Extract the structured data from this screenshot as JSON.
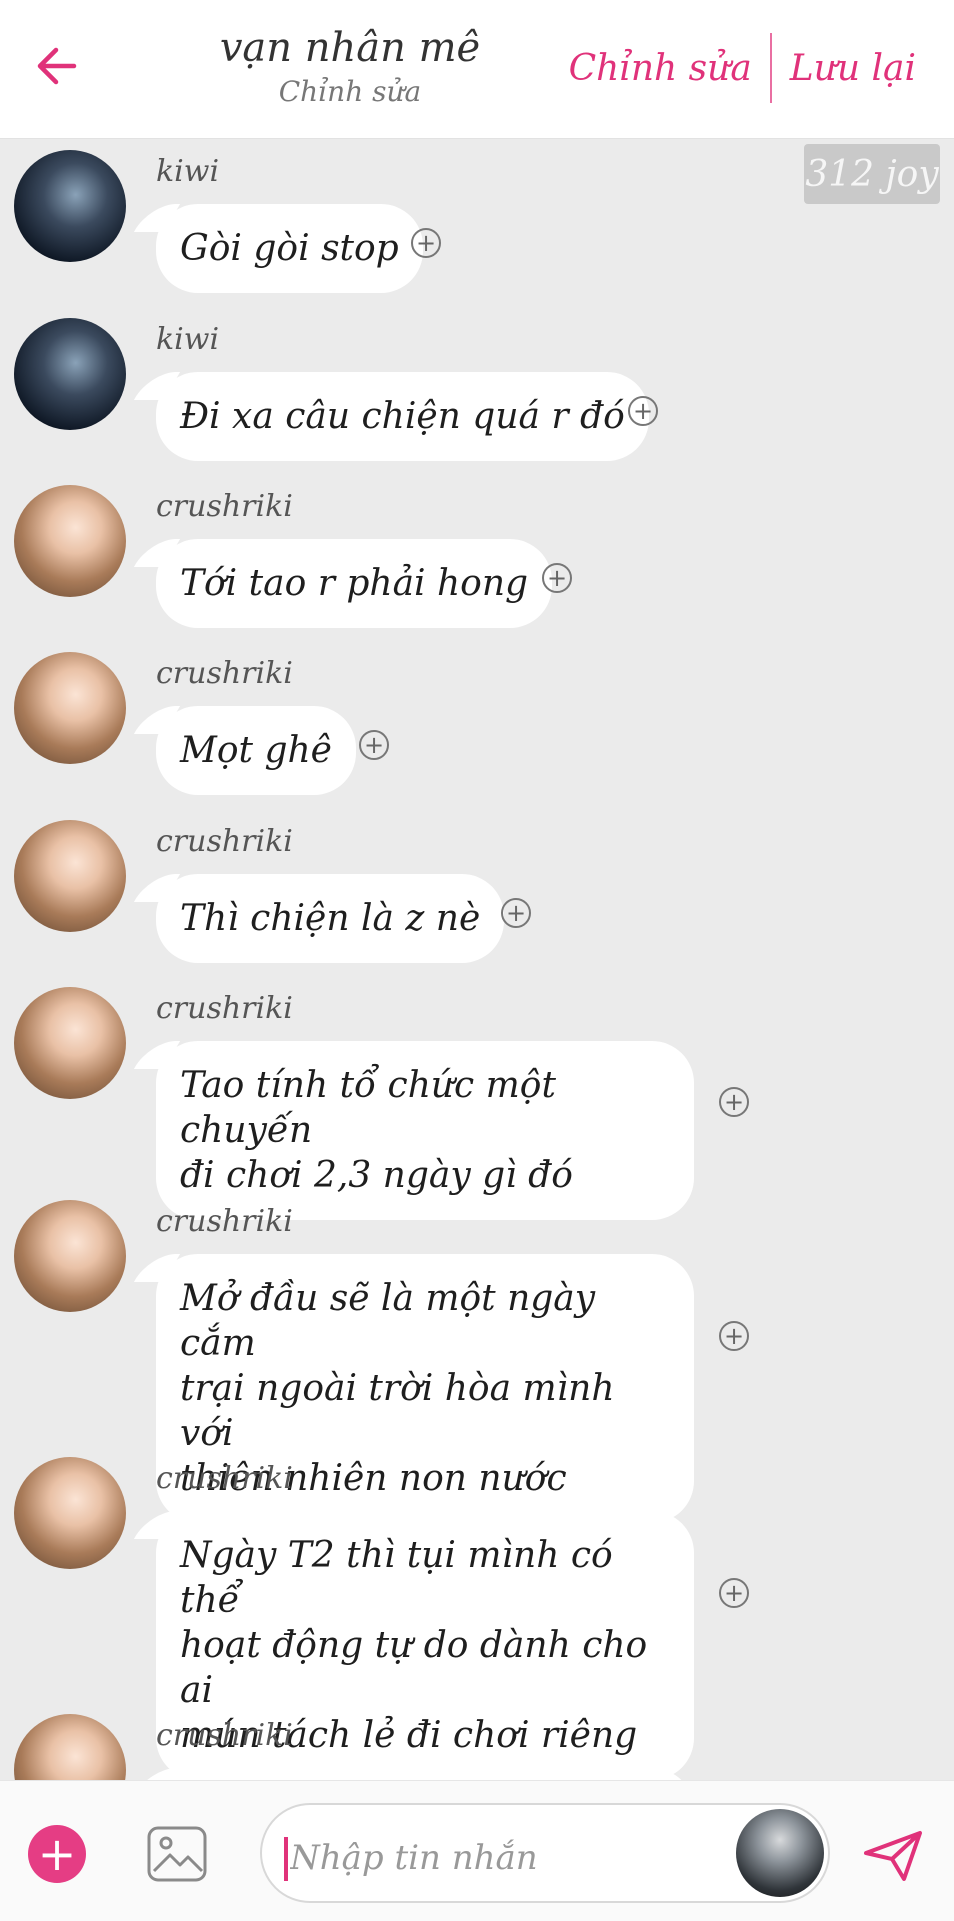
{
  "header": {
    "title": "vạn nhân mê",
    "subtitle": "Chỉnh sửa",
    "edit_label": "Chỉnh sửa",
    "save_label": "Lưu lại"
  },
  "watermark": "312 joy",
  "messages": [
    {
      "sender": "kiwi",
      "lines": [
        "Gòi gòi stop"
      ]
    },
    {
      "sender": "kiwi",
      "lines": [
        "Đi xa câu chiện quá r đó"
      ]
    },
    {
      "sender": "crushriki",
      "lines": [
        "Tới tao r phải hong"
      ]
    },
    {
      "sender": "crushriki",
      "lines": [
        "Mọt ghê"
      ]
    },
    {
      "sender": "crushriki",
      "lines": [
        "Thì chiện là z nè"
      ]
    },
    {
      "sender": "crushriki",
      "lines": [
        "Tao tính tổ chức một chuyến",
        "đi chơi 2,3 ngày gì đó"
      ]
    },
    {
      "sender": "crushriki",
      "lines": [
        "Mở đầu sẽ là một ngày cắm",
        "trại ngoài trời hòa mình với",
        "thiên nhiên non nước"
      ]
    },
    {
      "sender": "crushriki",
      "lines": [
        "Ngày T2 thì tụi mình có thể",
        "hoạt động tự do dành cho ai",
        "mún tách lẻ đi chơi riêng"
      ]
    },
    {
      "sender": "crushriki",
      "lines": []
    }
  ],
  "composer": {
    "placeholder": "Nhập tin nhắn"
  },
  "colors": {
    "accent": "#e0327a",
    "background": "#ebebeb",
    "bubble": "#ffffff"
  },
  "icons": {
    "back": "arrow-left-icon",
    "add_reaction": "plus-circle-icon",
    "add": "plus-icon",
    "image": "image-icon",
    "send": "send-icon"
  }
}
